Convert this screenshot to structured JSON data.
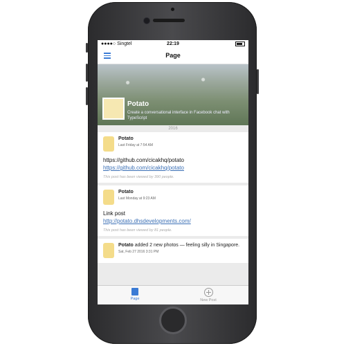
{
  "status_bar": {
    "carrier": "Singtel",
    "time": "22:19"
  },
  "navbar": {
    "title": "Page"
  },
  "page": {
    "name": "Potato",
    "description": "Create a conversational interface in Facebook chat with TypeScript",
    "year_divider": "2016"
  },
  "posts": [
    {
      "author": "Potato",
      "time": "Last Friday at 7:54 AM",
      "text": "https://github.com/cicakhq/potato",
      "link": "https://github.com/cicakhq/potato",
      "views": "This post has been viewed by 390 people."
    },
    {
      "author": "Potato",
      "time": "Last Monday at 9:23 AM",
      "text": "Link post",
      "link": "http://potato.dhsdevelopments.com/",
      "views": "This post has been viewed by 81 people."
    },
    {
      "author": "Potato",
      "activity": "added 2 new photos — feeling silly in Singapore.",
      "time": "Sat, Feb 27 2016 3:31 PM"
    }
  ],
  "tabbar": {
    "page_label": "Page",
    "new_post_label": "New Post"
  },
  "colors": {
    "accent": "#3a7bd5"
  }
}
